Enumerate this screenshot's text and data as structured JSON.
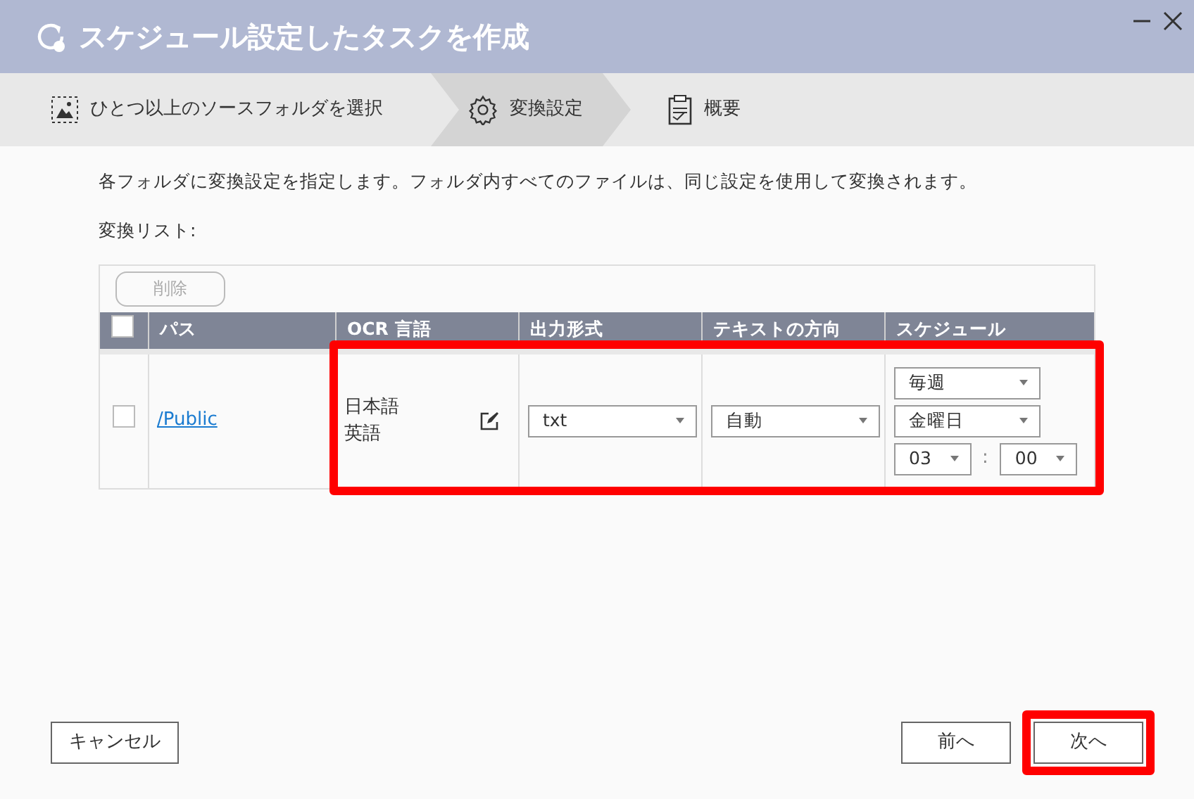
{
  "window": {
    "title": "スケジュール設定したタスクを作成"
  },
  "steps": [
    {
      "label": "ひとつ以上のソースフォルダを選択",
      "kind": "folder",
      "selected": false
    },
    {
      "label": "変換設定",
      "kind": "gear",
      "selected": true
    },
    {
      "label": "概要",
      "kind": "clipboard",
      "selected": false
    }
  ],
  "description": "各フォルダに変換設定を指定します。フォルダ内すべてのファイルは、同じ設定を使用して変換されます。",
  "list_label": "変換リスト:",
  "delete_button": {
    "label": "削除",
    "disabled": true
  },
  "table": {
    "header_checked": false,
    "columns": [
      "パス",
      "OCR 言語",
      "出力形式",
      "テキストの方向",
      "スケジュール"
    ],
    "rows": [
      {
        "checked": false,
        "path": "/Public",
        "languages": [
          "日本語",
          "英語"
        ],
        "format": "txt",
        "direction": "自動",
        "frequency": "毎週",
        "day": "金曜日",
        "hour": "03",
        "separator": ":",
        "minute": "00",
        "highlighted": true
      }
    ]
  },
  "buttons": [
    {
      "label": "キャンセル",
      "highlighted": false
    },
    {
      "label": "前へ",
      "highlighted": false
    },
    {
      "label": "次へ",
      "highlighted": true
    }
  ]
}
